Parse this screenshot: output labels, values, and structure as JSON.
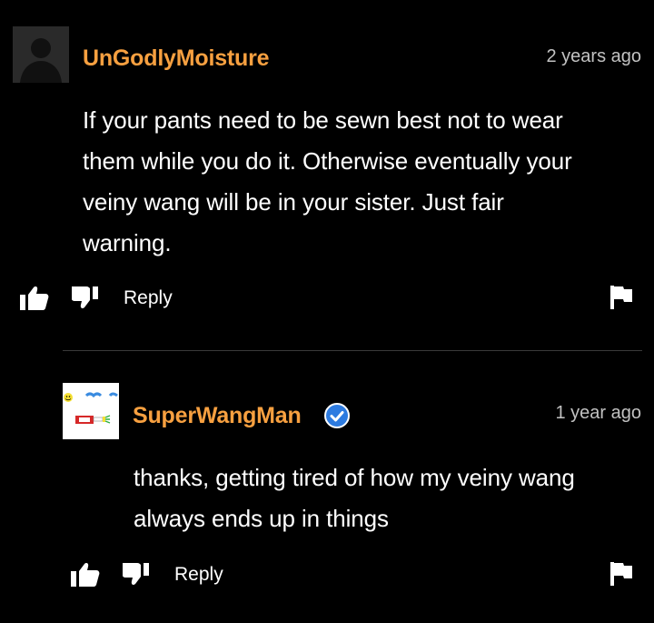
{
  "comments": [
    {
      "username": "UnGodlyMoisture",
      "timestamp": "2 years ago",
      "text_lines": [
        "If your pants need to be sewn best not to wear",
        "them while you do it. Otherwise eventually your",
        "veiny wang will be in your sister. Just fair",
        "warning."
      ],
      "verified": false,
      "reply_label": "Reply",
      "avatar_icon": "default-user-silhouette-icon"
    },
    {
      "username": "SuperWangMan",
      "timestamp": "1 year ago",
      "text_lines": [
        "thanks, getting tired of how my veiny wang",
        "always ends up in things"
      ],
      "verified": true,
      "reply_label": "Reply",
      "avatar_icon": "drawn-doodle-avatar-icon"
    }
  ],
  "colors": {
    "background": "#000000",
    "username": "#f7a040",
    "timestamp": "#c2c2c2",
    "verified_badge": "#2d7be0"
  }
}
